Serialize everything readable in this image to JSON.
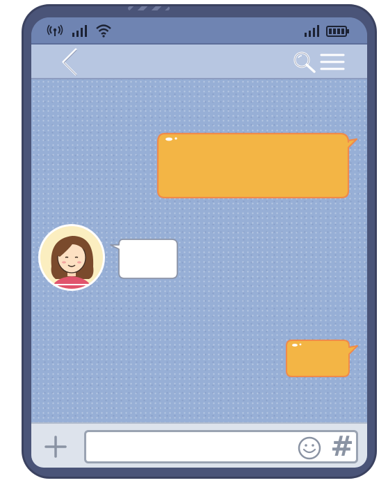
{
  "status_bar": {
    "icons": [
      "broadcast-icon",
      "signal-icon",
      "wifi-icon",
      "signal-icon",
      "battery-icon"
    ]
  },
  "nav_bar": {
    "icons": [
      "back-arrow-icon",
      "search-icon",
      "menu-icon"
    ]
  },
  "chat": {
    "messages": [
      {
        "sender": "me",
        "text": "",
        "bubble_color": "#f3b545"
      },
      {
        "sender": "contact",
        "text": "",
        "bubble_color": "#ffffff"
      },
      {
        "sender": "me",
        "text": "",
        "bubble_color": "#f3b545"
      }
    ],
    "contact_avatar": "girl-avatar"
  },
  "input_bar": {
    "message_value": "",
    "message_placeholder": "",
    "icons": [
      "plus-icon",
      "smiley-icon",
      "hashtag-icon"
    ],
    "hash_symbol": "#"
  },
  "colors": {
    "frame": "#4a5478",
    "status_bar": "#6f84b2",
    "nav_bar": "#b7c6e1",
    "chat_background": "#97afd6",
    "sent_bubble": "#f3b545",
    "sent_bubble_border": "#f08a4b",
    "received_bubble": "#ffffff",
    "input_bar": "#dde3ec"
  }
}
